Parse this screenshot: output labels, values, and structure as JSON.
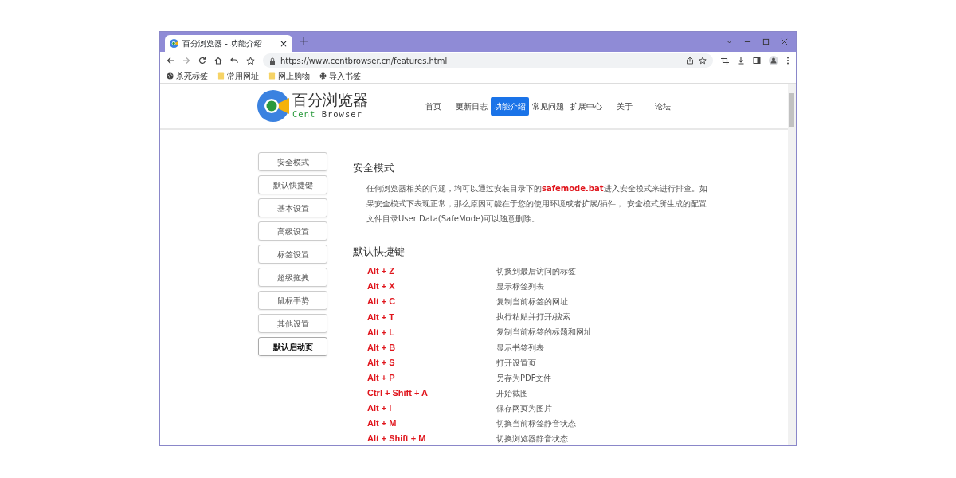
{
  "tab": {
    "title": "百分浏览器 - 功能介绍",
    "close": "×"
  },
  "new_tab": "+",
  "address_bar": {
    "url": "https://www.centbrowser.cn/features.html"
  },
  "bookmarks": [
    {
      "label": "杀死标签",
      "kind": "globe"
    },
    {
      "label": "常用网址",
      "kind": "folder"
    },
    {
      "label": "网上购物",
      "kind": "folder"
    },
    {
      "label": "导入书签",
      "kind": "gear"
    }
  ],
  "site": {
    "logo_title": "百分浏览器",
    "logo_subtitle_1": "Cent",
    "logo_subtitle_2": "Browser",
    "nav": [
      {
        "label": "首页",
        "selected": false
      },
      {
        "label": "更新日志",
        "selected": false
      },
      {
        "label": "功能介绍",
        "selected": true
      },
      {
        "label": "常见问题",
        "selected": false
      },
      {
        "label": "扩展中心",
        "selected": false
      },
      {
        "label": "关于",
        "selected": false
      },
      {
        "label": "论坛",
        "selected": false
      }
    ]
  },
  "sidebar": {
    "items": [
      {
        "label": "安全模式",
        "selected": false
      },
      {
        "label": "默认快捷键",
        "selected": false
      },
      {
        "label": "基本设置",
        "selected": false
      },
      {
        "label": "高级设置",
        "selected": false
      },
      {
        "label": "标签设置",
        "selected": false
      },
      {
        "label": "超级拖拽",
        "selected": false
      },
      {
        "label": "鼠标手势",
        "selected": false
      },
      {
        "label": "其他设置",
        "selected": false
      },
      {
        "label": "默认启动页",
        "selected": true
      }
    ]
  },
  "sections": [
    {
      "title": "安全模式",
      "text": "任何浏览器相关的问题，均可以通过安装目录下的**safemode.bat**进入安全模式来进行排查。如果安全模式下表现正常，那么原因可能在于您的使用环境或者扩展/插件， 安全模式所生成的配置文件目录User Data(SafeMode)可以随意删除。"
    },
    {
      "title": "默认快捷键",
      "shortcuts": [
        {
          "keys": "Alt + Z",
          "action": "切换到最后访问的标签"
        },
        {
          "keys": "Alt + X",
          "action": "显示标签列表"
        },
        {
          "keys": "Alt + C",
          "action": "复制当前标签的网址"
        },
        {
          "keys": "Alt + T",
          "action": "执行粘贴并打开/搜索"
        },
        {
          "keys": "Alt + L",
          "action": "复制当前标签的标题和网址"
        },
        {
          "keys": "Alt + B",
          "action": "显示书签列表"
        },
        {
          "keys": "Alt + S",
          "action": "打开设置页"
        },
        {
          "keys": "Alt + P",
          "action": "另存为PDF文件"
        },
        {
          "keys": "Ctrl + Shift + A",
          "action": "开始截图"
        },
        {
          "keys": "Alt + I",
          "action": "保存网页为图片"
        },
        {
          "keys": "Alt + M",
          "action": "切换当前标签静音状态"
        },
        {
          "keys": "Alt + Shift + M",
          "action": "切换浏览器静音状态"
        }
      ]
    }
  ]
}
